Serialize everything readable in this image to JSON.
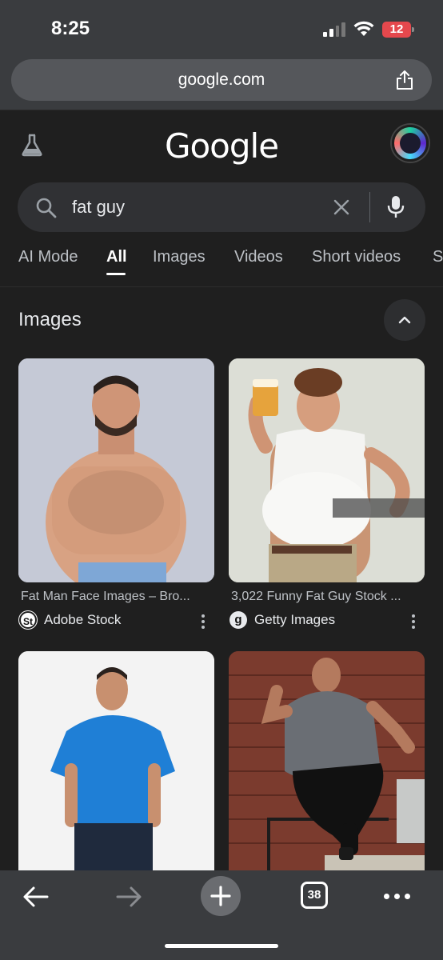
{
  "status_bar": {
    "time": "8:25",
    "battery": "12"
  },
  "browser": {
    "url": "google.com",
    "open_tabs": "38"
  },
  "google": {
    "logo": "Google"
  },
  "search": {
    "query": "fat guy"
  },
  "tabs": [
    {
      "label": "AI Mode"
    },
    {
      "label": "All",
      "active": true
    },
    {
      "label": "Images"
    },
    {
      "label": "Videos"
    },
    {
      "label": "Short videos"
    },
    {
      "label": "S"
    }
  ],
  "images_section": {
    "title": "Images",
    "results": [
      {
        "caption": "Fat Man Face Images – Bro...",
        "source": "Adobe Stock",
        "source_icon": "St"
      },
      {
        "caption": "3,022 Funny Fat Guy Stock ...",
        "source": "Getty Images",
        "source_icon": "g"
      }
    ]
  },
  "colors": {
    "background": "#1f1f1f",
    "chrome": "#3a3c3f",
    "search_box": "#303134",
    "battery": "#e5484d"
  }
}
